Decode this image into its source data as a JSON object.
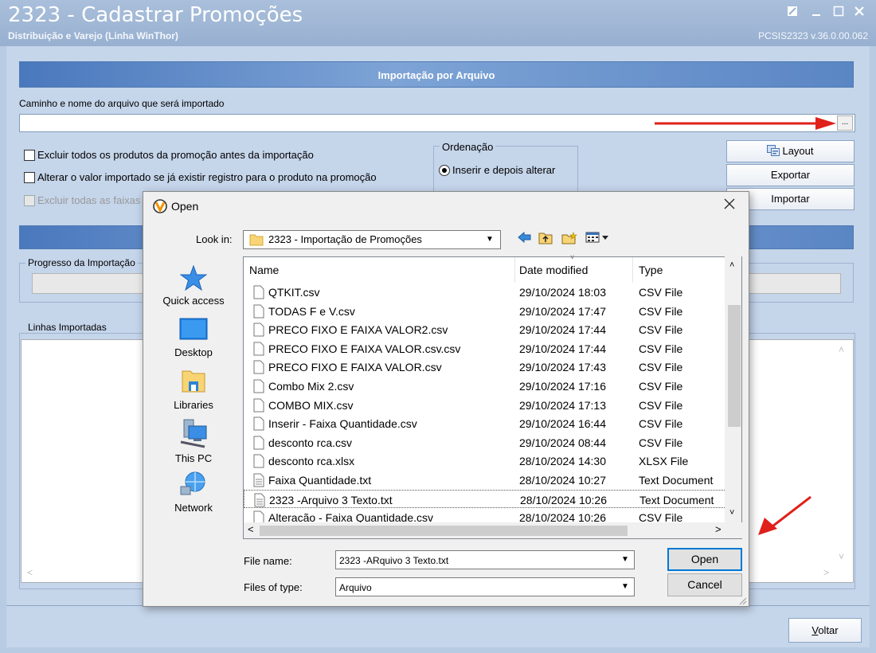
{
  "window": {
    "title": "2323 - Cadastrar Promoções",
    "subtitle": "Distribuição e Varejo (Linha WinThor)",
    "version": "PCSIS2323  v.36.0.00.062"
  },
  "import_section": {
    "header": "Importação por Arquivo",
    "path_label": "Caminho e nome do arquivo que será importado",
    "path_value": "",
    "browse_label": "...",
    "options": [
      {
        "label": "Excluir todos os produtos da promoção antes da importação",
        "checked": false
      },
      {
        "label": "Alterar o valor importado se já existir registro para o produto na promoção",
        "checked": false
      },
      {
        "label": "Excluir todas as faixas",
        "checked": false,
        "disabled": true
      }
    ],
    "ordering_legend": "Ordenação",
    "ordering_option": "Inserir e depois alterar",
    "buttons": {
      "layout": "Layout",
      "export": "Exportar",
      "import": "Importar"
    }
  },
  "progress": {
    "label": "Progresso da Importação"
  },
  "lines": {
    "label": "Linhas Importadas"
  },
  "footer": {
    "back_first": "V",
    "back_rest": "oltar"
  },
  "dialog": {
    "title": "Open",
    "look_in_label": "Look in:",
    "look_in_value": "2323 - Importação de Promoções",
    "places": [
      "Quick access",
      "Desktop",
      "Libraries",
      "This PC",
      "Network"
    ],
    "columns": {
      "name": "Name",
      "date": "Date modified",
      "type": "Type"
    },
    "files": [
      {
        "name": "QTKIT.csv",
        "date": "29/10/2024 18:03",
        "type": "CSV File"
      },
      {
        "name": "TODAS F e V.csv",
        "date": "29/10/2024 17:47",
        "type": "CSV File"
      },
      {
        "name": "PRECO FIXO E FAIXA VALOR2.csv",
        "date": "29/10/2024 17:44",
        "type": "CSV File"
      },
      {
        "name": "PRECO FIXO E FAIXA VALOR.csv.csv",
        "date": "29/10/2024 17:44",
        "type": "CSV File"
      },
      {
        "name": "PRECO FIXO E FAIXA VALOR.csv",
        "date": "29/10/2024 17:43",
        "type": "CSV File"
      },
      {
        "name": "Combo Mix 2.csv",
        "date": "29/10/2024 17:16",
        "type": "CSV File"
      },
      {
        "name": "COMBO MIX.csv",
        "date": "29/10/2024 17:13",
        "type": "CSV File"
      },
      {
        "name": "Inserir - Faixa Quantidade.csv",
        "date": "29/10/2024 16:44",
        "type": "CSV File"
      },
      {
        "name": "desconto rca.csv",
        "date": "29/10/2024 08:44",
        "type": "CSV File"
      },
      {
        "name": "desconto rca.xlsx",
        "date": "28/10/2024 14:30",
        "type": "XLSX File"
      },
      {
        "name": "Faixa Quantidade.txt",
        "date": "28/10/2024 10:27",
        "type": "Text Document"
      },
      {
        "name": "2323 -Arquivo 3 Texto.txt",
        "date": "28/10/2024 10:26",
        "type": "Text Document"
      },
      {
        "name": "Alteracão - Faixa Quantidade.csv",
        "date": "28/10/2024 10:26",
        "type": "CSV File"
      }
    ],
    "file_name_label": "File name:",
    "file_name_value": "2323 -ARquivo 3 Texto.txt",
    "file_type_label": "Files of type:",
    "file_type_value": "Arquivo",
    "open_label": "Open",
    "cancel_label": "Cancel"
  },
  "colors": {
    "annotation_arrow": "#e0201b",
    "header_blue": "#4a78bd",
    "focus_blue": "#0078d7"
  }
}
